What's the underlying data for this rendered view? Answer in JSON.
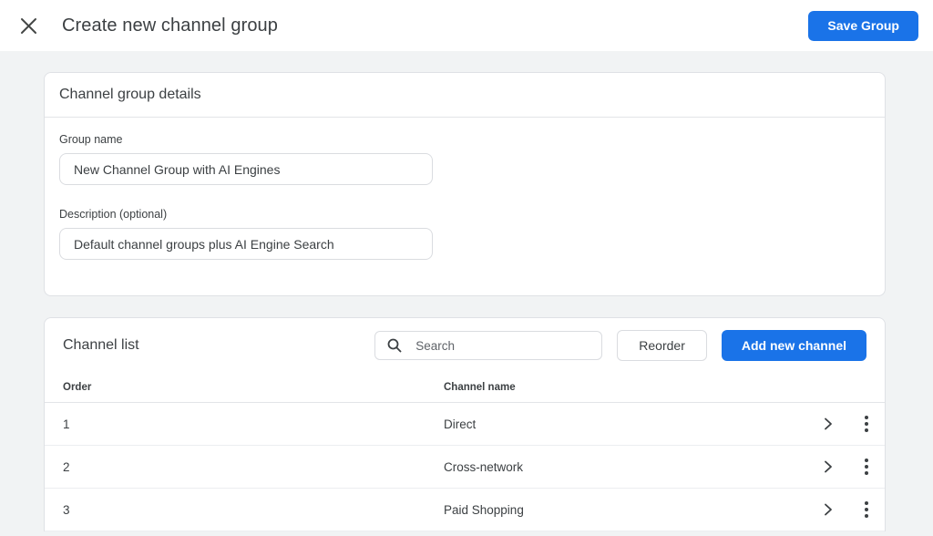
{
  "colors": {
    "accent": "#1a73e8",
    "page_background": "#f1f3f4"
  },
  "header": {
    "title": "Create new channel group",
    "save_button_label": "Save Group"
  },
  "details_card": {
    "title": "Channel group details",
    "group_name": {
      "label": "Group name",
      "value": "New Channel Group with AI Engines"
    },
    "description": {
      "label": "Description (optional)",
      "value": "Default channel groups plus AI Engine Search"
    }
  },
  "channel_list_card": {
    "title": "Channel list",
    "search_placeholder": "Search",
    "reorder_button_label": "Reorder",
    "add_button_label": "Add new channel",
    "columns": {
      "order": "Order",
      "channel_name": "Channel name"
    },
    "rows": [
      {
        "order": "1",
        "channel_name": "Direct"
      },
      {
        "order": "2",
        "channel_name": "Cross-network"
      },
      {
        "order": "3",
        "channel_name": "Paid Shopping"
      }
    ]
  }
}
